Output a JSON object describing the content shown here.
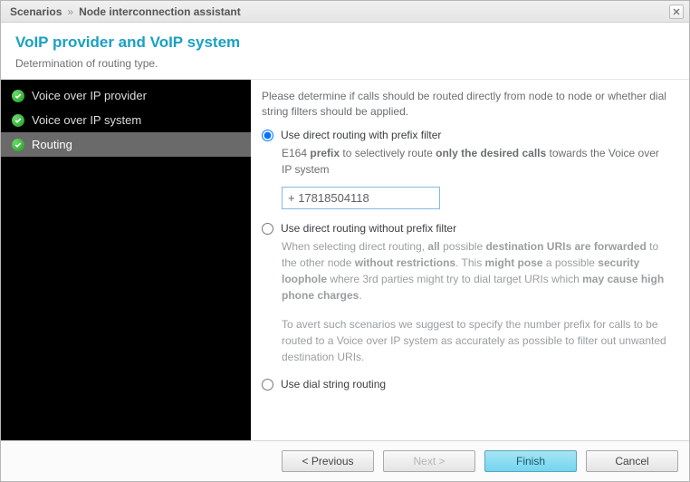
{
  "titlebar": {
    "crumb1": "Scenarios",
    "sep": "»",
    "crumb2": "Node interconnection assistant"
  },
  "header": {
    "title": "VoIP provider and VoIP system",
    "subtitle": "Determination of routing type."
  },
  "sidebar": {
    "steps": [
      {
        "label": "Voice over IP provider"
      },
      {
        "label": "Voice over IP system"
      },
      {
        "label": "Routing"
      }
    ]
  },
  "content": {
    "intro": "Please determine if calls should be routed directly from node to node or whether dial string filters should be applied.",
    "opt1": {
      "label": "Use direct routing with prefix filter",
      "desc_pre": "E164 ",
      "desc_bold1": "prefix",
      "desc_mid": " to selectively route ",
      "desc_bold2": "only the desired calls",
      "desc_post": " towards the Voice over IP system",
      "input_value": "+ 17818504118"
    },
    "opt2": {
      "label": "Use direct routing without prefix filter",
      "p1_a": "When selecting direct routing, ",
      "p1_b1": "all",
      "p1_b": " possible ",
      "p1_b2": "destination URIs are forwarded",
      "p1_c": " to the other node ",
      "p1_b3": "without restrictions",
      "p1_d": ". This ",
      "p1_b4": "might pose",
      "p1_e": " a possible ",
      "p1_b5": "security loophole",
      "p1_f": " where 3rd parties might try to dial target URIs which ",
      "p1_b6": "may cause high phone charges",
      "p1_g": ".",
      "p2": "To avert such scenarios we suggest to specify the number prefix for calls to be routed to a Voice over IP system as accurately as possible to filter out unwanted destination URIs."
    },
    "opt3": {
      "label": "Use dial string routing"
    }
  },
  "footer": {
    "prev": "< Previous",
    "next": "Next >",
    "finish": "Finish",
    "cancel": "Cancel"
  }
}
